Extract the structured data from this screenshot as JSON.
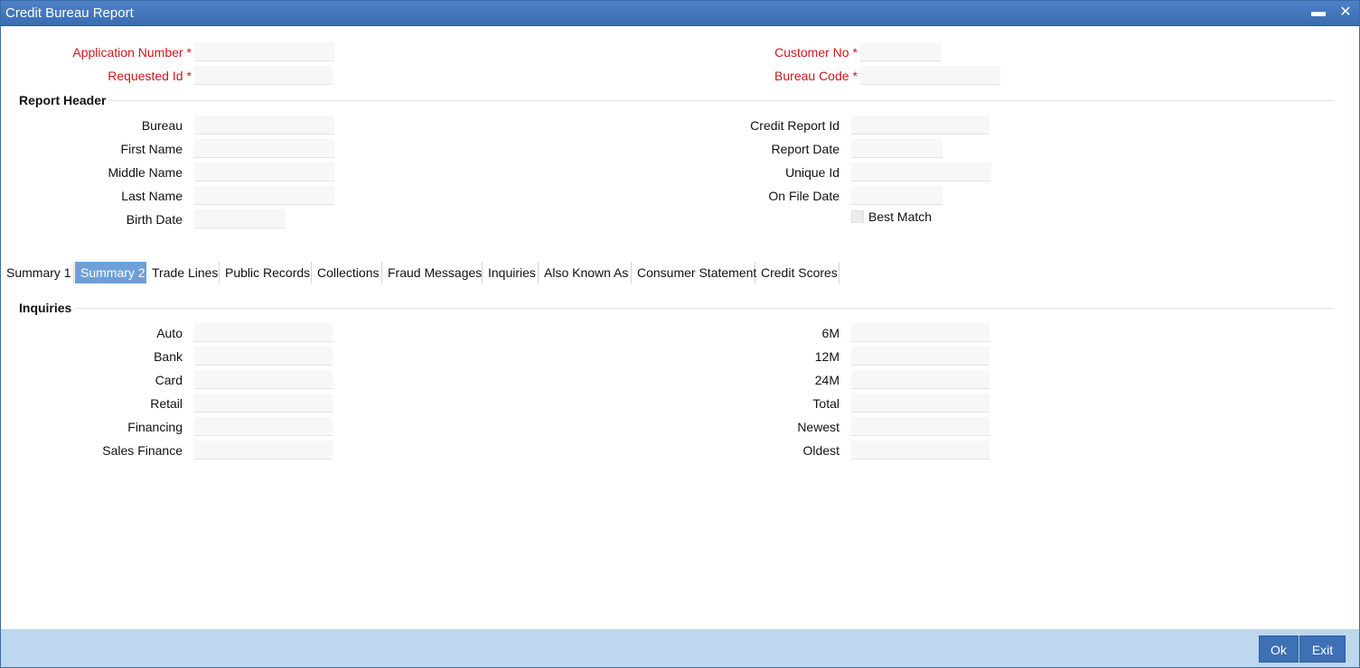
{
  "window": {
    "title": "Credit Bureau Report"
  },
  "controls": {
    "minimize": "▬",
    "close": "✕"
  },
  "key": {
    "application_number": "Application Number",
    "requested_id": "Requested Id",
    "customer_no": "Customer No",
    "bureau_code": "Bureau Code",
    "required_mark": "*"
  },
  "report_header": {
    "title": "Report Header",
    "bureau": "Bureau",
    "first_name": "First Name",
    "middle_name": "Middle Name",
    "last_name": "Last Name",
    "birth_date": "Birth Date",
    "credit_report_id": "Credit Report Id",
    "report_date": "Report Date",
    "unique_id": "Unique Id",
    "on_file_date": "On File Date",
    "best_match": "Best Match"
  },
  "tabs": [
    {
      "label": "Summary 1"
    },
    {
      "label": "Summary 2"
    },
    {
      "label": "Trade Lines"
    },
    {
      "label": "Public Records"
    },
    {
      "label": "Collections"
    },
    {
      "label": "Fraud Messages"
    },
    {
      "label": "Inquiries"
    },
    {
      "label": "Also Known As"
    },
    {
      "label": "Consumer Statement"
    },
    {
      "label": "Credit Scores"
    }
  ],
  "active_tab": "Summary 2",
  "inquiries": {
    "title": "Inquiries",
    "left": [
      "Auto",
      "Bank",
      "Card",
      "Retail",
      "Financing",
      "Sales Finance"
    ],
    "right": [
      "6M",
      "12M",
      "24M",
      "Total",
      "Newest",
      "Oldest"
    ]
  },
  "footer": {
    "ok": "Ok",
    "exit": "Exit"
  },
  "colors": {
    "title_bar": "#3a6cb2",
    "required": "#d1161a",
    "active_tab": "#6e9fd8",
    "footer": "#bdd7ee",
    "button": "#3d70b4"
  }
}
